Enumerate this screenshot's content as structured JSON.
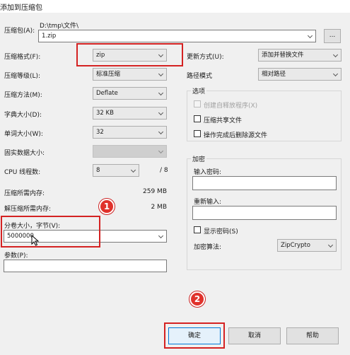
{
  "window": {
    "title": "添加到压缩包"
  },
  "archive": {
    "label": "压缩包(A):",
    "path": "D:\\tmp\\文件\\",
    "filename": "1.zip",
    "browse_label": "..."
  },
  "left": {
    "format": {
      "label": "压缩格式(F):",
      "value": "zip"
    },
    "level": {
      "label": "压缩等级(L):",
      "value": "标准压缩"
    },
    "method": {
      "label": "压缩方法(M):",
      "value": "Deflate"
    },
    "dictionary": {
      "label": "字典大小(D):",
      "value": "32 KB"
    },
    "word": {
      "label": "单词大小(W):",
      "value": "32"
    },
    "solid": {
      "label": "固实数据大小:",
      "value": ""
    },
    "threads": {
      "label": "CPU 线程数:",
      "value": "8",
      "total": "/ 8"
    },
    "mem_compress": {
      "label": "压缩所需内存:",
      "value": "259 MB"
    },
    "mem_decompress": {
      "label": "解压缩所需内存:",
      "value": "2 MB"
    },
    "split": {
      "label": "分卷大小，字节(V):",
      "value": "5000000"
    },
    "params": {
      "label": "参数(P):",
      "value": ""
    }
  },
  "right": {
    "update": {
      "label": "更新方式(U):",
      "value": "添加并替换文件"
    },
    "pathmode": {
      "label": "路径模式",
      "value": "相对路径"
    },
    "options": {
      "title": "选项",
      "sfx": "创建自释放程序(X)",
      "shared": "压缩共享文件",
      "delete_after": "操作完成后删除源文件"
    },
    "encryption": {
      "title": "加密",
      "password_label": "输入密码:",
      "reenter_label": "重新输入:",
      "show_password": "显示密码(S)",
      "method_label": "加密算法:",
      "method_value": "ZipCrypto"
    }
  },
  "buttons": {
    "ok": "确定",
    "cancel": "取消",
    "help": "帮助"
  },
  "annotations": {
    "badge1": "1",
    "badge2": "2"
  },
  "colors": {
    "highlight": "#d42222"
  }
}
